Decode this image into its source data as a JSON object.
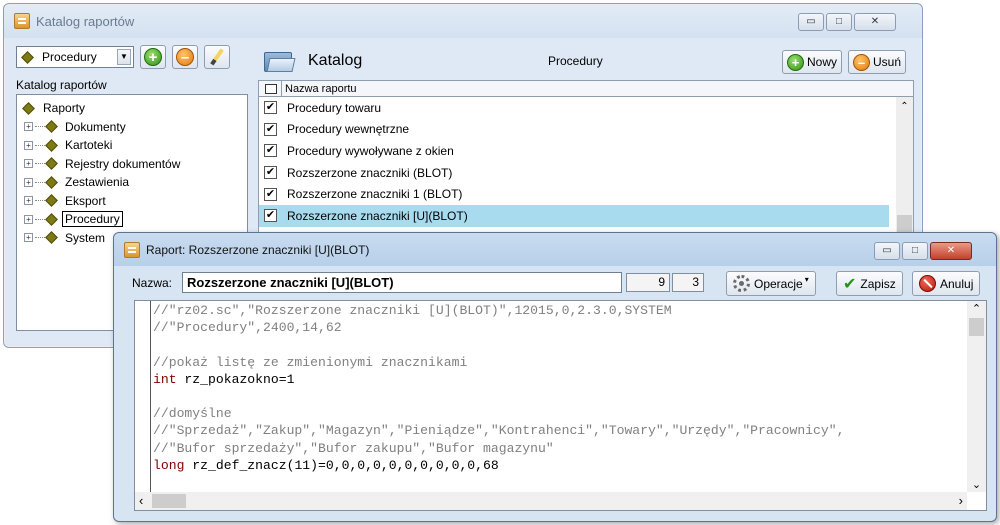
{
  "back_window": {
    "title": "Katalog raportów",
    "controls": {
      "minimize": "▭",
      "maximize": "□",
      "close": "✕"
    },
    "left": {
      "combo_value": "Procedury",
      "label": "Katalog raportów",
      "tree": [
        {
          "label": "Raporty",
          "expander": ""
        },
        {
          "label": "Dokumenty",
          "expander": "+"
        },
        {
          "label": "Kartoteki",
          "expander": "+"
        },
        {
          "label": "Rejestry dokumentów",
          "expander": "+"
        },
        {
          "label": "Zestawienia",
          "expander": "+"
        },
        {
          "label": "Eksport",
          "expander": "+"
        },
        {
          "label": "Procedury",
          "expander": "+"
        },
        {
          "label": "System",
          "expander": "+"
        }
      ]
    },
    "right": {
      "title": "Katalog",
      "subtitle": "Procedury",
      "new_button": "Nowy",
      "delete_button": "Usuń",
      "column_header": "Nazwa raportu",
      "rows": [
        "Procedury towaru",
        "Procedury wewnętrzne",
        "Procedury wywoływane z okien",
        "Rozszerzone znaczniki (BLOT)",
        "Rozszerzone znaczniki 1 (BLOT)",
        "Rozszerzone znaczniki [U](BLOT)"
      ],
      "selected_row": 5
    }
  },
  "front_window": {
    "title": "Raport: Rozszerzone znaczniki [U](BLOT)",
    "name_label": "Nazwa:",
    "name_value": "Rozszerzone znaczniki [U](BLOT)",
    "line": "9",
    "col": "3",
    "operations_button": "Operacje",
    "save_button": "Zapisz",
    "cancel_button": "Anuluj",
    "code_lines": [
      {
        "type": "comment",
        "text": "//\"rz02.sc\",\"Rozszerzone znaczniki [U](BLOT)\",12015,0,2.3.0,SYSTEM"
      },
      {
        "type": "comment",
        "text": "//\"Procedury\",2400,14,62"
      },
      {
        "type": "blank",
        "text": ""
      },
      {
        "type": "comment",
        "text": "//pokaż listę ze zmienionymi znacznikami"
      },
      {
        "type": "code",
        "kw": "int",
        "text": " rz_pokazokno=1"
      },
      {
        "type": "blank",
        "text": ""
      },
      {
        "type": "comment",
        "text": "//domyślne"
      },
      {
        "type": "comment",
        "text": "//\"Sprzedaż\",\"Zakup\",\"Magazyn\",\"Pieniądze\",\"Kontrahenci\",\"Towary\",\"Urzędy\",\"Pracownicy\","
      },
      {
        "type": "comment",
        "text": "//\"Bufor sprzedaży\",\"Bufor zakupu\",\"Bufor magazynu\""
      },
      {
        "type": "code",
        "kw": "long",
        "text": " rz_def_znacz(11)=0,0,0,0,0,0,0,0,0,0,68"
      }
    ]
  }
}
